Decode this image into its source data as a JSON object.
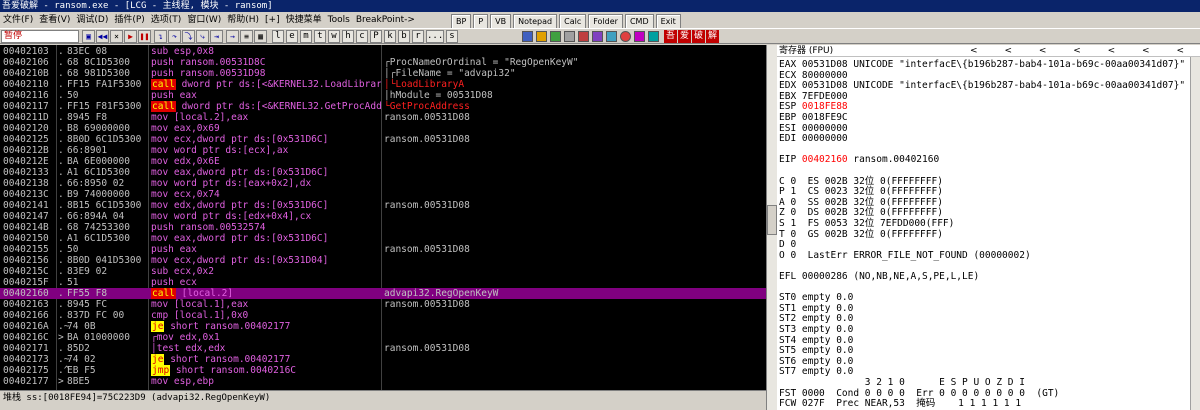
{
  "window": {
    "title": "吾爱破解 - ransom.exe - [LCG - 主线程, 模块 - ransom]"
  },
  "menu": [
    "文件(F)",
    "查看(V)",
    "调试(D)",
    "插件(P)",
    "选项(T)",
    "窗口(W)",
    "帮助(H)",
    "[+]",
    "快捷菜单",
    "Tools",
    "BreakPoint->"
  ],
  "quick_buttons": [
    "BP",
    "P",
    "VB",
    "Notepad",
    "Calc",
    "Folder",
    "CMD",
    "Exit"
  ],
  "toolbar": {
    "status": "暂停",
    "letters": [
      "l",
      "e",
      "m",
      "t",
      "w",
      "h",
      "c",
      "P",
      "k",
      "b",
      "r",
      "...",
      "s"
    ],
    "text_buttons": [
      "吾",
      "爱",
      "破",
      "解"
    ]
  },
  "disasm": [
    {
      "addr": "00402103",
      "mark": ".",
      "hex": "83EC 08",
      "mn": "sub",
      "mnc": "plain",
      "ops": "esp,0x8",
      "cmt": "",
      "cmtc": ""
    },
    {
      "addr": "00402106",
      "mark": ".",
      "hex": "68 8C1D5300",
      "mn": "push",
      "mnc": "push",
      "ops": "ransom.00531D8C",
      "cmt": "┌ProcNameOrOrdinal = \"RegOpenKeyW\"",
      "cmtc": ""
    },
    {
      "addr": "0040210B",
      "mark": ".",
      "hex": "68 981D5300",
      "mn": "push",
      "mnc": "push",
      "ops": "ransom.00531D98",
      "cmt": "│┌FileName = \"advapi32\"",
      "cmtc": ""
    },
    {
      "addr": "00402110",
      "mark": ".",
      "hex": "FF15 FA1F5300",
      "mn": "call",
      "mnc": "call",
      "ops": "dword ptr ds:[<&KERNEL32.LoadLibrar",
      "cmt": "│└LoadLibraryA",
      "cmtc": "red"
    },
    {
      "addr": "00402116",
      "mark": ".",
      "hex": "50",
      "mn": "push",
      "mnc": "push",
      "ops": "eax",
      "cmt": "│hModule = 00531D08",
      "cmtc": ""
    },
    {
      "addr": "00402117",
      "mark": ".",
      "hex": "FF15 F81F5300",
      "mn": "call",
      "mnc": "call",
      "ops": "dword ptr ds:[<&KERNEL32.GetProcAdd",
      "cmt": "└GetProcAddress",
      "cmtc": "red"
    },
    {
      "addr": "0040211D",
      "mark": ".",
      "hex": "8945 F8",
      "mn": "mov",
      "mnc": "plain",
      "ops": "[local.2],eax",
      "cmt": "ransom.00531D08",
      "cmtc": ""
    },
    {
      "addr": "00402120",
      "mark": ".",
      "hex": "B8 69000000",
      "mn": "mov",
      "mnc": "plain",
      "ops": "eax,0x69",
      "cmt": "",
      "cmtc": ""
    },
    {
      "addr": "00402125",
      "mark": ".",
      "hex": "8B0D 6C1D5300",
      "mn": "mov",
      "mnc": "plain",
      "ops": "ecx,dword ptr ds:[0x531D6C]",
      "cmt": "ransom.00531D08",
      "cmtc": ""
    },
    {
      "addr": "0040212B",
      "mark": ".",
      "hex": "66:8901",
      "mn": "mov",
      "mnc": "plain",
      "ops": "word ptr ds:[ecx],ax",
      "cmt": "",
      "cmtc": ""
    },
    {
      "addr": "0040212E",
      "mark": ".",
      "hex": "BA 6E000000",
      "mn": "mov",
      "mnc": "plain",
      "ops": "edx,0x6E",
      "cmt": "",
      "cmtc": ""
    },
    {
      "addr": "00402133",
      "mark": ".",
      "hex": "A1 6C1D5300",
      "mn": "mov",
      "mnc": "plain",
      "ops": "eax,dword ptr ds:[0x531D6C]",
      "cmt": "",
      "cmtc": ""
    },
    {
      "addr": "00402138",
      "mark": ".",
      "hex": "66:8950 02",
      "mn": "mov",
      "mnc": "plain",
      "ops": "word ptr ds:[eax+0x2],dx",
      "cmt": "",
      "cmtc": ""
    },
    {
      "addr": "0040213C",
      "mark": ".",
      "hex": "B9 74000000",
      "mn": "mov",
      "mnc": "plain",
      "ops": "ecx,0x74",
      "cmt": "",
      "cmtc": ""
    },
    {
      "addr": "00402141",
      "mark": ".",
      "hex": "8B15 6C1D5300",
      "mn": "mov",
      "mnc": "plain",
      "ops": "edx,dword ptr ds:[0x531D6C]",
      "cmt": "ransom.00531D08",
      "cmtc": ""
    },
    {
      "addr": "00402147",
      "mark": ".",
      "hex": "66:894A 04",
      "mn": "mov",
      "mnc": "plain",
      "ops": "word ptr ds:[edx+0x4],cx",
      "cmt": "",
      "cmtc": ""
    },
    {
      "addr": "0040214B",
      "mark": ".",
      "hex": "68 74253300",
      "mn": "push",
      "mnc": "push",
      "ops": "ransom.00532574",
      "cmt": "",
      "cmtc": ""
    },
    {
      "addr": "00402150",
      "mark": ".",
      "hex": "A1 6C1D5300",
      "mn": "mov",
      "mnc": "plain",
      "ops": "eax,dword ptr ds:[0x531D6C]",
      "cmt": "",
      "cmtc": ""
    },
    {
      "addr": "00402155",
      "mark": ".",
      "hex": "50",
      "mn": "push",
      "mnc": "push",
      "ops": "eax",
      "cmt": "ransom.00531D08",
      "cmtc": ""
    },
    {
      "addr": "00402156",
      "mark": ".",
      "hex": "8B0D 041D5300",
      "mn": "mov",
      "mnc": "plain",
      "ops": "ecx,dword ptr ds:[0x531D04]",
      "cmt": "",
      "cmtc": ""
    },
    {
      "addr": "0040215C",
      "mark": ".",
      "hex": "83E9 02",
      "mn": "sub",
      "mnc": "plain",
      "ops": "ecx,0x2",
      "cmt": "",
      "cmtc": ""
    },
    {
      "addr": "0040215F",
      "mark": ".",
      "hex": "51",
      "mn": "push",
      "mnc": "push",
      "ops": "ecx",
      "cmt": "",
      "cmtc": ""
    },
    {
      "addr": "00402160",
      "mark": ".",
      "hex": "FF55 F8",
      "mn": "call",
      "mnc": "call",
      "ops": "[local.2]",
      "cmt": "advapi32.RegOpenKeyW",
      "cmtc": "",
      "selected": true
    },
    {
      "addr": "00402163",
      "mark": ".",
      "hex": "8945 FC",
      "mn": "mov",
      "mnc": "plain",
      "ops": "[local.1],eax",
      "cmt": "ransom.00531D08",
      "cmtc": ""
    },
    {
      "addr": "00402166",
      "mark": ".",
      "hex": "837D FC 00",
      "mn": "cmp",
      "mnc": "plain",
      "ops": "[local.1],0x0",
      "cmt": "",
      "cmtc": ""
    },
    {
      "addr": "0040216A",
      "mark": ".~",
      "hex": "74 0B",
      "mn": "je",
      "mnc": "jcc",
      "ops": "short ransom.00402177",
      "cmt": "",
      "cmtc": ""
    },
    {
      "addr": "0040216C",
      "mark": ">",
      "hex": "BA 01000000",
      "mn": "┌mov",
      "mnc": "plain",
      "ops": "edx,0x1",
      "cmt": "",
      "cmtc": ""
    },
    {
      "addr": "00402171",
      "mark": ".",
      "hex": "85D2",
      "mn": "│test",
      "mnc": "plain",
      "ops": "edx,edx",
      "cmt": "ransom.00531D08",
      "cmtc": ""
    },
    {
      "addr": "00402173",
      "mark": ".~",
      "hex": "74 02",
      "mn": "je",
      "mnc": "jcc",
      "ops": "short ransom.00402177",
      "cmt": "",
      "cmtc": ""
    },
    {
      "addr": "00402175",
      "mark": ".^",
      "hex": "EB F5",
      "mn": "jmp",
      "mnc": "jmp",
      "ops": "short ransom.0040216C",
      "cmt": "",
      "cmtc": ""
    },
    {
      "addr": "00402177",
      "mark": ">",
      "hex": "8BE5",
      "mn": "mov",
      "mnc": "plain",
      "ops": "esp,ebp",
      "cmt": "",
      "cmtc": ""
    }
  ],
  "info_line": "堆栈 ss:[0018FE94]=75C223D9 (advapi32.RegOpenKeyW)",
  "regs": {
    "header": "寄存器 (FPU)",
    "nav": "< < < < < < <",
    "rows": [
      {
        "t": "EAX 00531D08 UNICODE \"interfacE\\{b196b287-bab4-101a-b69c-00aa00341d07}\"",
        "c": ""
      },
      {
        "t": "ECX 80000000",
        "c": ""
      },
      {
        "t": "EDX 00531D08 UNICODE \"interfacE\\{b196b287-bab4-101a-b69c-00aa00341d07}\"",
        "c": ""
      },
      {
        "t": "EBX 7EFDE000",
        "c": ""
      },
      {
        "t": "ESP 0018FE88",
        "c": "esp"
      },
      {
        "t": "EBP 0018FE9C",
        "c": ""
      },
      {
        "t": "ESI 00000000",
        "c": ""
      },
      {
        "t": "EDI 00000000",
        "c": ""
      },
      {
        "t": "",
        "c": ""
      },
      {
        "t": "EIP 00402160 ransom.00402160",
        "c": "eip"
      },
      {
        "t": "",
        "c": ""
      },
      {
        "t": "C 0  ES 002B 32位 0(FFFFFFFF)",
        "c": ""
      },
      {
        "t": "P 1  CS 0023 32位 0(FFFFFFFF)",
        "c": ""
      },
      {
        "t": "A 0  SS 002B 32位 0(FFFFFFFF)",
        "c": ""
      },
      {
        "t": "Z 0  DS 002B 32位 0(FFFFFFFF)",
        "c": ""
      },
      {
        "t": "S 1  FS 0053 32位 7EFDD000(FFF)",
        "c": ""
      },
      {
        "t": "T 0  GS 002B 32位 0(FFFFFFFF)",
        "c": ""
      },
      {
        "t": "D 0",
        "c": ""
      },
      {
        "t": "O 0  LastErr ERROR_FILE_NOT_FOUND (00000002)",
        "c": ""
      },
      {
        "t": "",
        "c": ""
      },
      {
        "t": "EFL 00000286 (NO,NB,NE,A,S,PE,L,LE)",
        "c": ""
      },
      {
        "t": "",
        "c": ""
      },
      {
        "t": "ST0 empty 0.0",
        "c": ""
      },
      {
        "t": "ST1 empty 0.0",
        "c": ""
      },
      {
        "t": "ST2 empty 0.0",
        "c": ""
      },
      {
        "t": "ST3 empty 0.0",
        "c": ""
      },
      {
        "t": "ST4 empty 0.0",
        "c": ""
      },
      {
        "t": "ST5 empty 0.0",
        "c": ""
      },
      {
        "t": "ST6 empty 0.0",
        "c": ""
      },
      {
        "t": "ST7 empty 0.0",
        "c": ""
      },
      {
        "t": "               3 2 1 0      E S P U O Z D I",
        "c": ""
      },
      {
        "t": "FST 0000  Cond 0 0 0 0  Err 0 0 0 0 0 0 0 0  (GT)",
        "c": ""
      },
      {
        "t": "FCW 027F  Prec NEAR,53  掩码    1 1 1 1 1 1",
        "c": ""
      }
    ]
  },
  "colors": {
    "selected_row": "#800080",
    "call_bg": "#e00000",
    "jump_bg": "#ffff00",
    "disasm_bg": "#000000",
    "register_changed": "#ff0000"
  }
}
